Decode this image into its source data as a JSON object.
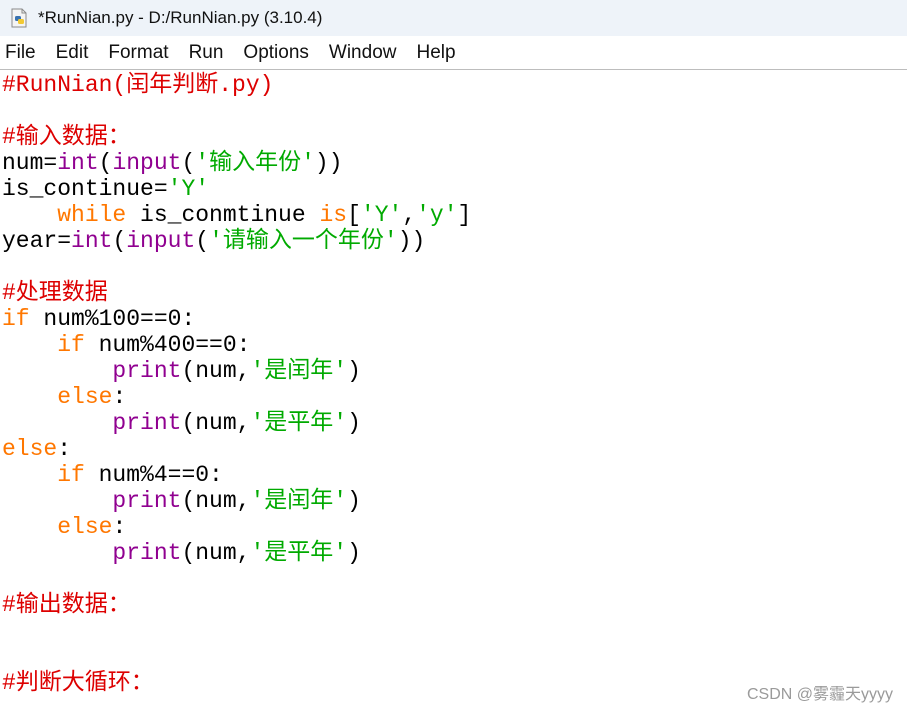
{
  "window": {
    "title": "*RunNian.py - D:/RunNian.py (3.10.4)"
  },
  "menu": [
    "File",
    "Edit",
    "Format",
    "Run",
    "Options",
    "Window",
    "Help"
  ],
  "code": {
    "l1": "#RunNian(闰年判断.py)",
    "l3": "#输入数据：",
    "l4": {
      "a": "num=",
      "b": "int",
      "c": "(",
      "d": "input",
      "e": "(",
      "f": "'输入年份'",
      "g": "))"
    },
    "l5": {
      "a": "is_continue=",
      "b": "'Y'"
    },
    "l6": {
      "indent": "    ",
      "a": "while",
      "b": " is_conmtinue ",
      "c": "is",
      "d": "[",
      "e": "'Y'",
      "f": ",",
      "g": "'y'",
      "h": "]"
    },
    "l7": {
      "a": "year=",
      "b": "int",
      "c": "(",
      "d": "input",
      "e": "(",
      "f": "'请输入一个年份'",
      "g": "))"
    },
    "l9": "#处理数据",
    "l10": {
      "a": "if",
      "b": " num%100==0:"
    },
    "l11": {
      "indent": "    ",
      "a": "if",
      "b": " num%400==0:"
    },
    "l12": {
      "indent": "        ",
      "a": "print",
      "b": "(num,",
      "c": "'是闰年'",
      "d": ")"
    },
    "l13": {
      "indent": "    ",
      "a": "else",
      "b": ":"
    },
    "l14": {
      "indent": "        ",
      "a": "print",
      "b": "(num,",
      "c": "'是平年'",
      "d": ")"
    },
    "l15": {
      "a": "else",
      "b": ":"
    },
    "l16": {
      "indent": "    ",
      "a": "if",
      "b": " num%4==0:"
    },
    "l17": {
      "indent": "        ",
      "a": "print",
      "b": "(num,",
      "c": "'是闰年'",
      "d": ")"
    },
    "l18": {
      "indent": "    ",
      "a": "else",
      "b": ":"
    },
    "l19": {
      "indent": "        ",
      "a": "print",
      "b": "(num,",
      "c": "'是平年'",
      "d": ")"
    },
    "l21": "#输出数据：",
    "l23": "#判断大循环："
  },
  "watermark": "CSDN @雾霾天yyyy",
  "icons": {
    "app": "python-file-icon"
  },
  "colors": {
    "keyword": "#ff7700",
    "builtin": "#900090",
    "string": "#00aa00",
    "comment": "#dd0000"
  }
}
